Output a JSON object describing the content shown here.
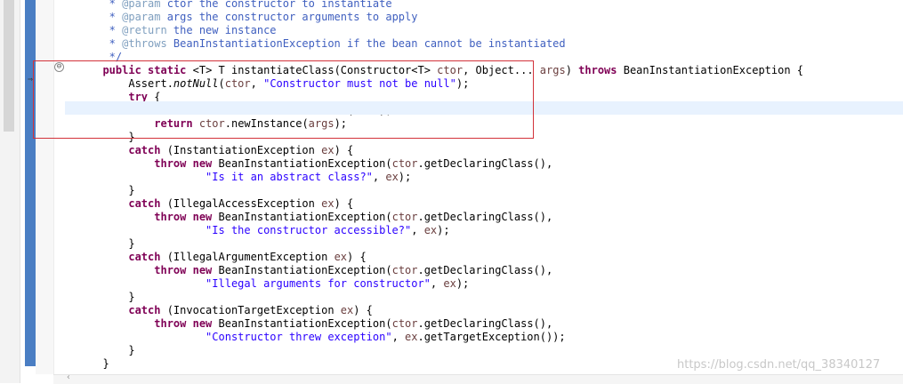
{
  "editor": {
    "lines": [
      {
        "tokens": [
          {
            "t": "   * ",
            "c": "#3f5fbf"
          },
          {
            "t": "@param",
            "c": "#7f9fbf"
          },
          {
            "t": " ctor the constructor to instantiate",
            "c": "#3f5fbf"
          }
        ]
      },
      {
        "tokens": [
          {
            "t": "   * ",
            "c": "#3f5fbf"
          },
          {
            "t": "@param",
            "c": "#7f9fbf"
          },
          {
            "t": " args the constructor arguments to apply",
            "c": "#3f5fbf"
          }
        ]
      },
      {
        "tokens": [
          {
            "t": "   * ",
            "c": "#3f5fbf"
          },
          {
            "t": "@return",
            "c": "#7f9fbf"
          },
          {
            "t": " the new instance",
            "c": "#3f5fbf"
          }
        ]
      },
      {
        "tokens": [
          {
            "t": "   * ",
            "c": "#3f5fbf"
          },
          {
            "t": "@throws",
            "c": "#7f9fbf"
          },
          {
            "t": " BeanInstantiationException if the bean cannot be instantiated",
            "c": "#3f5fbf"
          }
        ]
      },
      {
        "tokens": [
          {
            "t": "   */",
            "c": "#3f5fbf"
          }
        ]
      },
      {
        "tokens": [
          {
            "t": "  ",
            "c": "#000000"
          },
          {
            "t": "public",
            "c": "#7f0055",
            "b": true
          },
          {
            "t": " ",
            "c": "#000000"
          },
          {
            "t": "static",
            "c": "#7f0055",
            "b": true
          },
          {
            "t": " <T> T instantiateClass(Constructor<T> ",
            "c": "#000000"
          },
          {
            "t": "ctor",
            "c": "#6a3e3e"
          },
          {
            "t": ", Object... ",
            "c": "#000000"
          },
          {
            "t": "args",
            "c": "#6a3e3e"
          },
          {
            "t": ") ",
            "c": "#000000"
          },
          {
            "t": "throws",
            "c": "#7f0055",
            "b": true
          },
          {
            "t": " BeanInstantiationException {",
            "c": "#000000"
          }
        ]
      },
      {
        "tokens": [
          {
            "t": "      Assert.",
            "c": "#000000"
          },
          {
            "t": "notNull",
            "c": "#000000",
            "i": true
          },
          {
            "t": "(",
            "c": "#000000"
          },
          {
            "t": "ctor",
            "c": "#6a3e3e"
          },
          {
            "t": ", ",
            "c": "#000000"
          },
          {
            "t": "\"Constructor must not be null\"",
            "c": "#2a00ff"
          },
          {
            "t": ");",
            "c": "#000000"
          }
        ]
      },
      {
        "tokens": [
          {
            "t": "      ",
            "c": "#000000"
          },
          {
            "t": "try",
            "c": "#7f0055",
            "b": true
          },
          {
            "t": " {",
            "c": "#000000"
          }
        ]
      },
      {
        "tokens": [
          {
            "t": "          ReflectionUtils.",
            "c": "#000000"
          },
          {
            "t": "makeAccessible",
            "c": "#000000",
            "i": true
          },
          {
            "t": "(",
            "c": "#000000"
          },
          {
            "t": "ctor",
            "c": "#6a3e3e"
          },
          {
            "t": ");",
            "c": "#000000"
          }
        ]
      },
      {
        "tokens": [
          {
            "t": "          ",
            "c": "#000000"
          },
          {
            "t": "return",
            "c": "#7f0055",
            "b": true
          },
          {
            "t": " ",
            "c": "#000000"
          },
          {
            "t": "ctor",
            "c": "#6a3e3e"
          },
          {
            "t": ".newInstance(",
            "c": "#000000"
          },
          {
            "t": "args",
            "c": "#6a3e3e"
          },
          {
            "t": ");",
            "c": "#000000"
          }
        ]
      },
      {
        "tokens": [
          {
            "t": "      }",
            "c": "#000000"
          }
        ]
      },
      {
        "tokens": [
          {
            "t": "      ",
            "c": "#000000"
          },
          {
            "t": "catch",
            "c": "#7f0055",
            "b": true
          },
          {
            "t": " (InstantiationException ",
            "c": "#000000"
          },
          {
            "t": "ex",
            "c": "#6a3e3e"
          },
          {
            "t": ") {",
            "c": "#000000"
          }
        ]
      },
      {
        "tokens": [
          {
            "t": "          ",
            "c": "#000000"
          },
          {
            "t": "throw",
            "c": "#7f0055",
            "b": true
          },
          {
            "t": " ",
            "c": "#000000"
          },
          {
            "t": "new",
            "c": "#7f0055",
            "b": true
          },
          {
            "t": " BeanInstantiationException(",
            "c": "#000000"
          },
          {
            "t": "ctor",
            "c": "#6a3e3e"
          },
          {
            "t": ".getDeclaringClass(),",
            "c": "#000000"
          }
        ]
      },
      {
        "tokens": [
          {
            "t": "                  ",
            "c": "#000000"
          },
          {
            "t": "\"Is it an abstract class?\"",
            "c": "#2a00ff"
          },
          {
            "t": ", ",
            "c": "#000000"
          },
          {
            "t": "ex",
            "c": "#6a3e3e"
          },
          {
            "t": ");",
            "c": "#000000"
          }
        ]
      },
      {
        "tokens": [
          {
            "t": "      }",
            "c": "#000000"
          }
        ]
      },
      {
        "tokens": [
          {
            "t": "      ",
            "c": "#000000"
          },
          {
            "t": "catch",
            "c": "#7f0055",
            "b": true
          },
          {
            "t": " (IllegalAccessException ",
            "c": "#000000"
          },
          {
            "t": "ex",
            "c": "#6a3e3e"
          },
          {
            "t": ") {",
            "c": "#000000"
          }
        ]
      },
      {
        "tokens": [
          {
            "t": "          ",
            "c": "#000000"
          },
          {
            "t": "throw",
            "c": "#7f0055",
            "b": true
          },
          {
            "t": " ",
            "c": "#000000"
          },
          {
            "t": "new",
            "c": "#7f0055",
            "b": true
          },
          {
            "t": " BeanInstantiationException(",
            "c": "#000000"
          },
          {
            "t": "ctor",
            "c": "#6a3e3e"
          },
          {
            "t": ".getDeclaringClass(),",
            "c": "#000000"
          }
        ]
      },
      {
        "tokens": [
          {
            "t": "                  ",
            "c": "#000000"
          },
          {
            "t": "\"Is the constructor accessible?\"",
            "c": "#2a00ff"
          },
          {
            "t": ", ",
            "c": "#000000"
          },
          {
            "t": "ex",
            "c": "#6a3e3e"
          },
          {
            "t": ");",
            "c": "#000000"
          }
        ]
      },
      {
        "tokens": [
          {
            "t": "      }",
            "c": "#000000"
          }
        ]
      },
      {
        "tokens": [
          {
            "t": "      ",
            "c": "#000000"
          },
          {
            "t": "catch",
            "c": "#7f0055",
            "b": true
          },
          {
            "t": " (IllegalArgumentException ",
            "c": "#000000"
          },
          {
            "t": "ex",
            "c": "#6a3e3e"
          },
          {
            "t": ") {",
            "c": "#000000"
          }
        ]
      },
      {
        "tokens": [
          {
            "t": "          ",
            "c": "#000000"
          },
          {
            "t": "throw",
            "c": "#7f0055",
            "b": true
          },
          {
            "t": " ",
            "c": "#000000"
          },
          {
            "t": "new",
            "c": "#7f0055",
            "b": true
          },
          {
            "t": " BeanInstantiationException(",
            "c": "#000000"
          },
          {
            "t": "ctor",
            "c": "#6a3e3e"
          },
          {
            "t": ".getDeclaringClass(),",
            "c": "#000000"
          }
        ]
      },
      {
        "tokens": [
          {
            "t": "                  ",
            "c": "#000000"
          },
          {
            "t": "\"Illegal arguments for constructor\"",
            "c": "#2a00ff"
          },
          {
            "t": ", ",
            "c": "#000000"
          },
          {
            "t": "ex",
            "c": "#6a3e3e"
          },
          {
            "t": ");",
            "c": "#000000"
          }
        ]
      },
      {
        "tokens": [
          {
            "t": "      }",
            "c": "#000000"
          }
        ]
      },
      {
        "tokens": [
          {
            "t": "      ",
            "c": "#000000"
          },
          {
            "t": "catch",
            "c": "#7f0055",
            "b": true
          },
          {
            "t": " (InvocationTargetException ",
            "c": "#000000"
          },
          {
            "t": "ex",
            "c": "#6a3e3e"
          },
          {
            "t": ") {",
            "c": "#000000"
          }
        ]
      },
      {
        "tokens": [
          {
            "t": "          ",
            "c": "#000000"
          },
          {
            "t": "throw",
            "c": "#7f0055",
            "b": true
          },
          {
            "t": " ",
            "c": "#000000"
          },
          {
            "t": "new",
            "c": "#7f0055",
            "b": true
          },
          {
            "t": " BeanInstantiationException(",
            "c": "#000000"
          },
          {
            "t": "ctor",
            "c": "#6a3e3e"
          },
          {
            "t": ".getDeclaringClass(),",
            "c": "#000000"
          }
        ]
      },
      {
        "tokens": [
          {
            "t": "                  ",
            "c": "#000000"
          },
          {
            "t": "\"Constructor threw exception\"",
            "c": "#2a00ff"
          },
          {
            "t": ", ",
            "c": "#000000"
          },
          {
            "t": "ex",
            "c": "#6a3e3e"
          },
          {
            "t": ".getTargetException());",
            "c": "#000000"
          }
        ]
      },
      {
        "tokens": [
          {
            "t": "      }",
            "c": "#000000"
          }
        ]
      },
      {
        "tokens": [
          {
            "t": "  }",
            "c": "#000000"
          }
        ]
      }
    ]
  },
  "gutter": {
    "fold_icon": "collapse-circle-icon",
    "fold_symbol": "⊖",
    "marker_icon": "breakpoint-arrow-icon",
    "marker_symbol": "⇒"
  },
  "watermark": {
    "text": "https://blog.csdn.net/qq_38340127"
  },
  "colors": {
    "keyword": "#7f0055",
    "string": "#2a00ff",
    "variable": "#6a3e3e",
    "javadoc": "#3f5fbf",
    "javadoc_tag": "#7f9fbf",
    "overview_bar": "#4a7ec3",
    "selection_border": "#d2323a",
    "current_line": "#e8f2fe"
  }
}
